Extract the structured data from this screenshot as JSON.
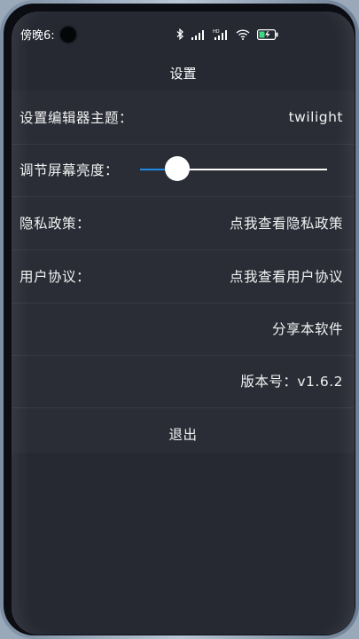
{
  "status_bar": {
    "time": "傍晚6:",
    "icons": [
      "bluetooth-icon",
      "signal-icon",
      "hd-signal-icon",
      "wifi-icon",
      "battery-charging-icon"
    ]
  },
  "header": {
    "title": "设置"
  },
  "settings": {
    "theme": {
      "label": "设置编辑器主题：",
      "value": "twilight"
    },
    "brightness": {
      "label": "调节屏幕亮度：",
      "level": 0.2
    },
    "privacy": {
      "label": "隐私政策：",
      "value": "点我查看隐私政策"
    },
    "agreement": {
      "label": "用户协议：",
      "value": "点我查看用户协议"
    },
    "share": {
      "label": "分享本软件"
    },
    "version": {
      "label": "版本号：v1.6.2"
    },
    "logout": {
      "label": "退出"
    }
  },
  "colors": {
    "background": "#2a2d36",
    "slider_active": "#1e88e5",
    "text": "#ffffff"
  }
}
